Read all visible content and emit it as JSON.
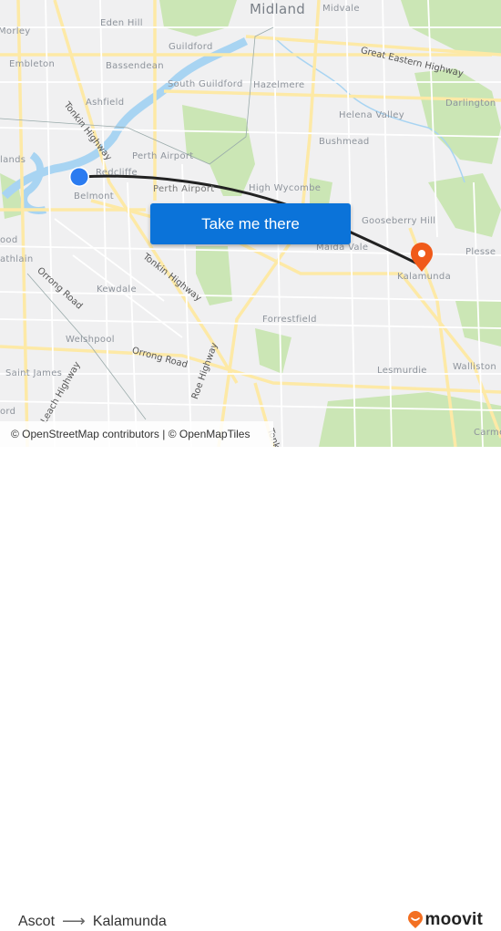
{
  "map": {
    "places": [
      {
        "name": "Midland",
        "size": "big"
      },
      {
        "name": "Midvale"
      },
      {
        "name": "Eden Hill"
      },
      {
        "name": "Morley"
      },
      {
        "name": "Guildford"
      },
      {
        "name": "Embleton"
      },
      {
        "name": "Bassendean"
      },
      {
        "name": "South Guildford"
      },
      {
        "name": "Hazelmere"
      },
      {
        "name": "Ashfield"
      },
      {
        "name": "Darlington"
      },
      {
        "name": "Helena Valley"
      },
      {
        "name": "Bushmead"
      },
      {
        "name": "Perth Airport"
      },
      {
        "name": "Redcliffe"
      },
      {
        "name": "Perth Airport"
      },
      {
        "name": "lands"
      },
      {
        "name": "Belmont"
      },
      {
        "name": "High Wycombe"
      },
      {
        "name": "Gooseberry Hill"
      },
      {
        "name": "ood"
      },
      {
        "name": "Maida Vale"
      },
      {
        "name": "athlain"
      },
      {
        "name": "Plesse"
      },
      {
        "name": "Kalamunda"
      },
      {
        "name": "Kewdale"
      },
      {
        "name": "Forrestfield"
      },
      {
        "name": "Welshpool"
      },
      {
        "name": "Saint James"
      },
      {
        "name": "Lesmurdie"
      },
      {
        "name": "Walliston"
      },
      {
        "name": "ord"
      },
      {
        "name": "Carme"
      }
    ],
    "roads": [
      {
        "name": "Great Eastern Highway"
      },
      {
        "name": "Tonkin Highway"
      },
      {
        "name": "Tonkin Highway"
      },
      {
        "name": "Orrong Road"
      },
      {
        "name": "Orrong Road"
      },
      {
        "name": "Roe Highway"
      },
      {
        "name": "Leach Highway"
      },
      {
        "name": "Tonkin"
      }
    ],
    "origin_marker": "origin-dot",
    "destination_marker": "destination-pin",
    "colors": {
      "origin": "#2b7bf0",
      "destination": "#f05a1a",
      "route": "#222222",
      "cta": "#0b73d9"
    }
  },
  "cta": {
    "label": "Take me there"
  },
  "attribution": "© OpenStreetMap contributors | © OpenMapTiles",
  "footer": {
    "origin": "Ascot",
    "arrow": "⟶",
    "destination": "Kalamunda",
    "brand": "moovit",
    "brand_color": "#f36f21"
  }
}
